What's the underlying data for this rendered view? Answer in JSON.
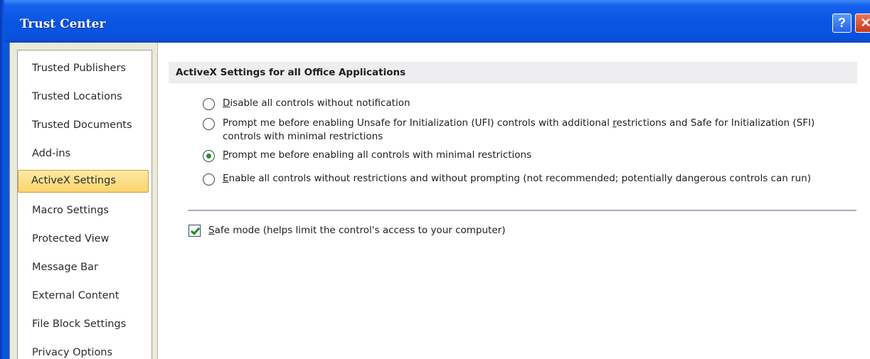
{
  "window": {
    "title": "Trust Center",
    "help_label": "?",
    "close_label": "✕"
  },
  "sidebar": {
    "items": [
      {
        "label": "Trusted Publishers"
      },
      {
        "label": "Trusted Locations"
      },
      {
        "label": "Trusted Documents"
      },
      {
        "label": "Add-ins"
      },
      {
        "label": "ActiveX Settings",
        "selected": true
      },
      {
        "label": "Macro Settings"
      },
      {
        "label": "Protected View"
      },
      {
        "label": "Message Bar"
      },
      {
        "label": "External Content"
      },
      {
        "label": "File Block Settings"
      },
      {
        "label": "Privacy Options"
      }
    ]
  },
  "main": {
    "section_title": "ActiveX Settings for all Office Applications",
    "options": [
      {
        "label_start": "",
        "label_accel": "D",
        "label_rest": "isable all controls without notification",
        "checked": false
      },
      {
        "label_start": "Prompt me before enabling Unsafe for Initialization (UFI) controls with additional ",
        "label_accel": "r",
        "label_rest": "estrictions and Safe for Initialization (SFI) controls with minimal restrictions",
        "checked": false
      },
      {
        "label_start": "",
        "label_accel": "P",
        "label_rest": "rompt me before enabling all controls with minimal restrictions",
        "checked": true
      },
      {
        "label_start": "",
        "label_accel": "E",
        "label_rest": "nable all controls without restrictions and without prompting (not recommended; potentially dangerous controls can run)",
        "checked": false
      }
    ],
    "safe_mode": {
      "label_accel": "S",
      "label_rest": "afe mode (helps limit the control's access to your computer)",
      "checked": true
    }
  },
  "colors": {
    "title_bar": "#0a55e3",
    "selected_nav": "#fbd46b",
    "radio_dot": "#2e8a2e",
    "check_mark": "#1f8b1f"
  }
}
